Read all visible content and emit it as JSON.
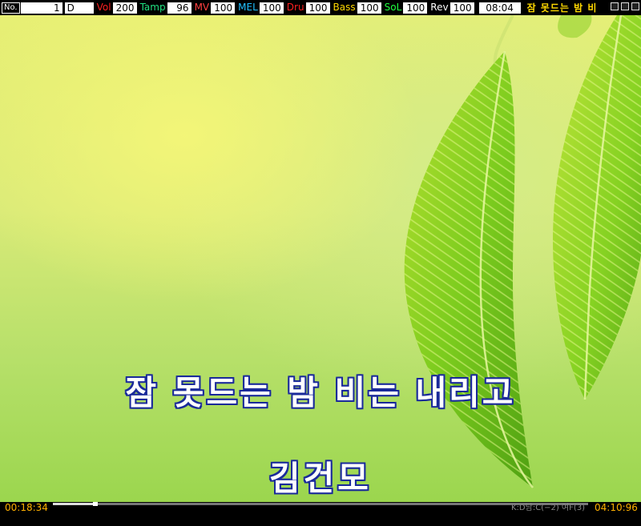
{
  "status": {
    "no_label": "No.",
    "no_value": "1",
    "key_value": "D",
    "vol_label": "Vol",
    "vol_value": "200",
    "tamp_label": "Tamp",
    "tamp_value": "96",
    "mv_label": "MV",
    "mv_value": "100",
    "mel_label": "MEL",
    "mel_value": "100",
    "dru_label": "Dru",
    "dru_value": "100",
    "bass_label": "Bass",
    "bass_value": "100",
    "sol_label": "SoL",
    "sol_value": "100",
    "rev_label": "Rev",
    "rev_value": "100",
    "clock": "08:04",
    "song_title": "잠 못드는 밤 비"
  },
  "lyrics": {
    "title": "잠 못드는 밤 비는 내리고",
    "artist": "김건모"
  },
  "playback": {
    "elapsed": "00:18:34",
    "total": "04:10:96",
    "key_info": "K:D남:C(−2) 여F(3)",
    "progress": 0.08
  },
  "colors": {
    "vol": "#ff2020",
    "tamp": "#20e080",
    "mv": "#ff4040",
    "mel": "#20c0ff",
    "dru": "#ff2020",
    "bass": "#ffd800",
    "sol": "#20ff40",
    "rev": "#ffffff",
    "lyric_outline": "#1a2a9a",
    "time": "#ffb000"
  },
  "icons": {
    "minimize": "minimize-icon",
    "maximize": "maximize-icon",
    "close": "close-icon"
  }
}
